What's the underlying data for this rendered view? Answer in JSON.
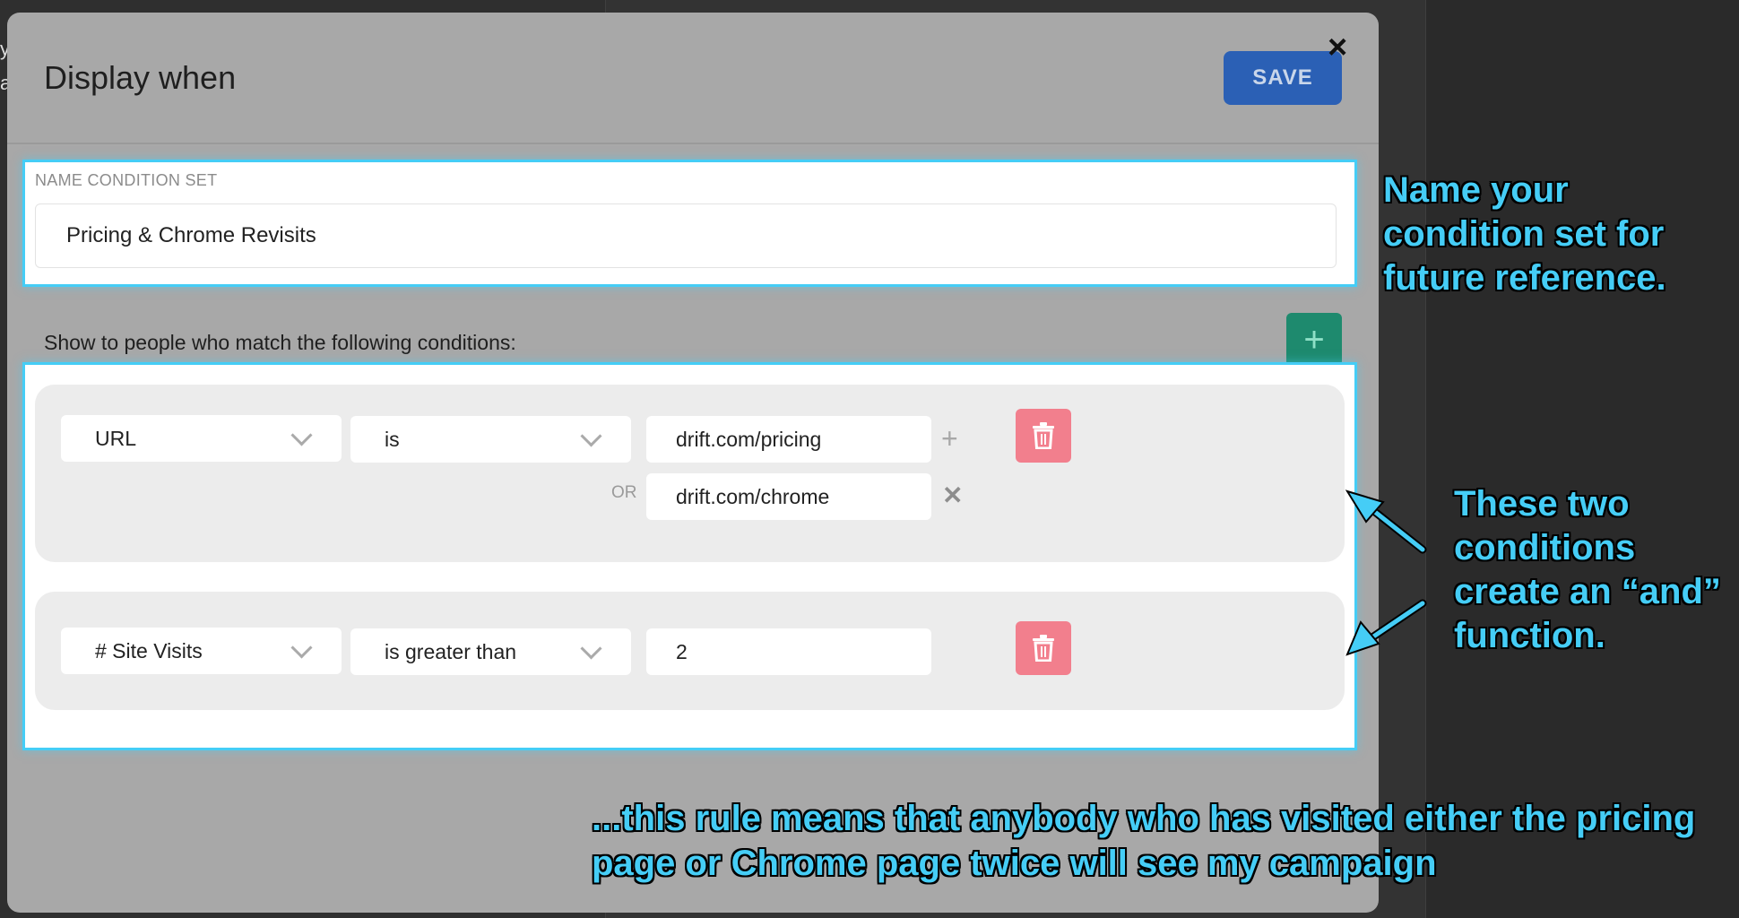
{
  "background": {
    "cut_chars": [
      "y",
      "a"
    ]
  },
  "modal": {
    "title": "Display when",
    "save_label": "SAVE",
    "close_icon": "×",
    "name_label": "NAME CONDITION SET",
    "name_value": "Pricing & Chrome Revisits",
    "conditions_prompt": "Show to people who match the following conditions:",
    "add_icon": "+",
    "conditions": [
      {
        "field": "URL",
        "operator": "is",
        "values": [
          "drift.com/pricing",
          "drift.com/chrome"
        ],
        "or_label": "OR"
      },
      {
        "field": "# Site Visits",
        "operator": "is greater than",
        "values": [
          "2"
        ]
      }
    ]
  },
  "annotations": {
    "name_note": [
      "Name your",
      "condition set for",
      "future reference."
    ],
    "and_note": [
      "These two",
      "conditions",
      "create an “and”",
      "function."
    ],
    "rule_note": [
      "...this rule means that anybody who has visited either the pricing",
      "page or Chrome page twice will see my campaign"
    ]
  },
  "colors": {
    "highlight": "#45cdf6",
    "save": "#2b60b5",
    "add": "#1e8a6e",
    "delete": "#f27f8d"
  }
}
